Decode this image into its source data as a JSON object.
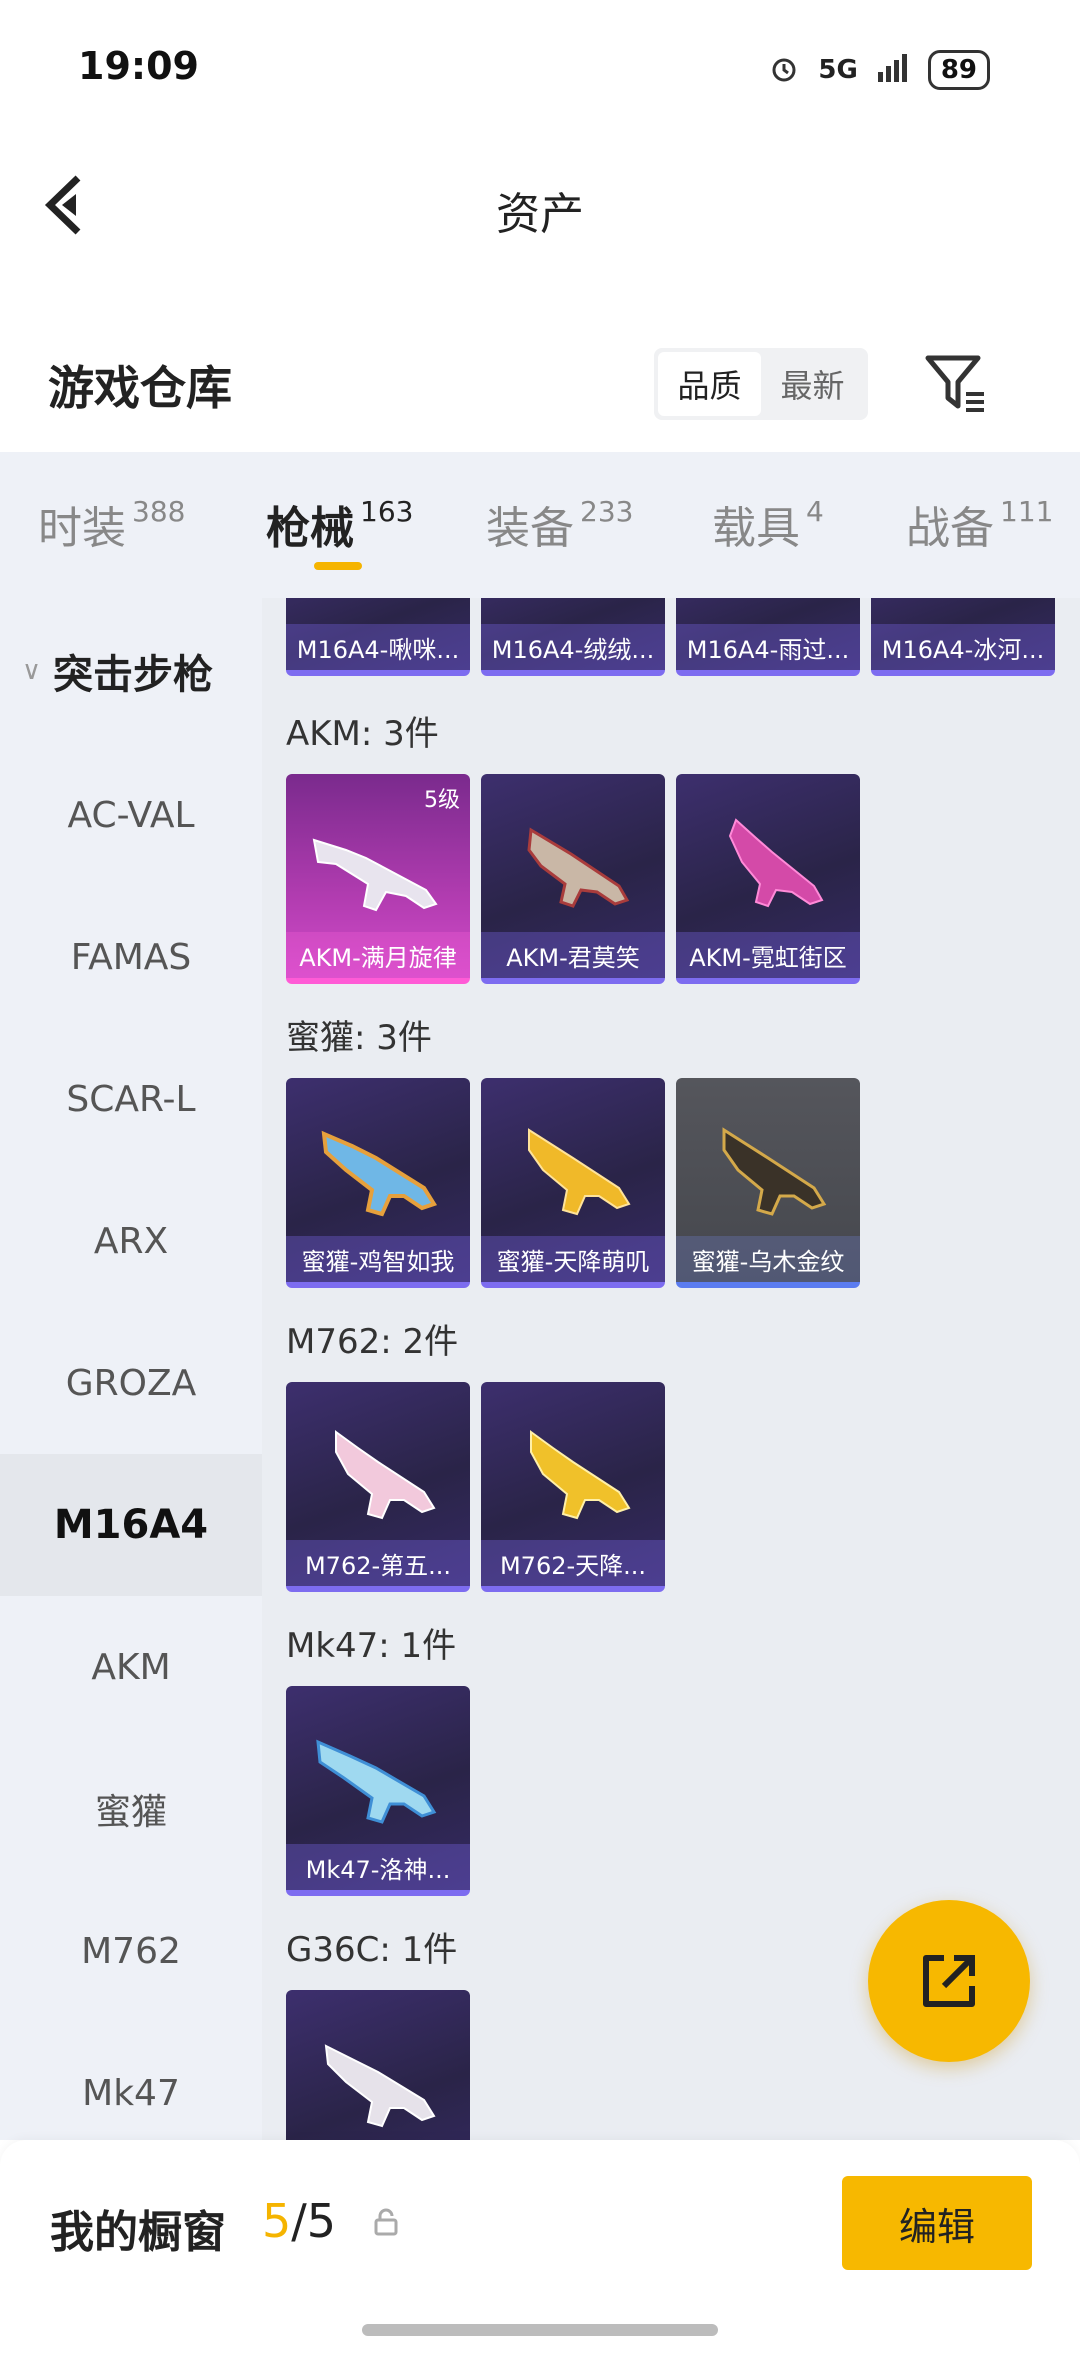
{
  "status": {
    "time": "19:09",
    "signal": "5G",
    "battery": "89"
  },
  "header": {
    "title": "资产"
  },
  "warehouse": {
    "title": "游戏仓库",
    "sort_options": [
      "品质",
      "最新"
    ]
  },
  "tabs": [
    {
      "label": "时装",
      "count": "388"
    },
    {
      "label": "枪械",
      "count": "163"
    },
    {
      "label": "装备",
      "count": "233"
    },
    {
      "label": "载具",
      "count": "4"
    },
    {
      "label": "战备",
      "count": "111"
    }
  ],
  "sidebar": {
    "category": "突击步枪",
    "items": [
      "AC-VAL",
      "FAMAS",
      "SCAR-L",
      "ARX",
      "GROZA",
      "M16A4",
      "AKM",
      "蜜獾",
      "M762",
      "Mk47"
    ]
  },
  "groups": [
    {
      "title": "",
      "items": [
        "M16A4-啾咪...",
        "M16A4-绒绒...",
        "M16A4-雨过...",
        "M16A4-冰河..."
      ]
    },
    {
      "title": "AKM: 3件",
      "items": [
        "AKM-满月旋律",
        "AKM-君莫笑",
        "AKM-霓虹街区"
      ],
      "level": "5级"
    },
    {
      "title": "蜜獾: 3件",
      "items": [
        "蜜獾-鸡智如我",
        "蜜獾-天降萌叽",
        "蜜獾-乌木金纹"
      ]
    },
    {
      "title": "M762: 2件",
      "items": [
        "M762-第五...",
        "M762-天降..."
      ]
    },
    {
      "title": "Mk47: 1件",
      "items": [
        "Mk47-洛神..."
      ]
    },
    {
      "title": "G36C: 1件",
      "items": [
        ""
      ]
    }
  ],
  "bottom": {
    "label": "我的橱窗",
    "current": "5",
    "total": "/5",
    "edit": "编辑"
  },
  "colors": {
    "accent": "#F7B800",
    "card_purple": "#2A2448",
    "card_pink": "#B13CB0"
  }
}
